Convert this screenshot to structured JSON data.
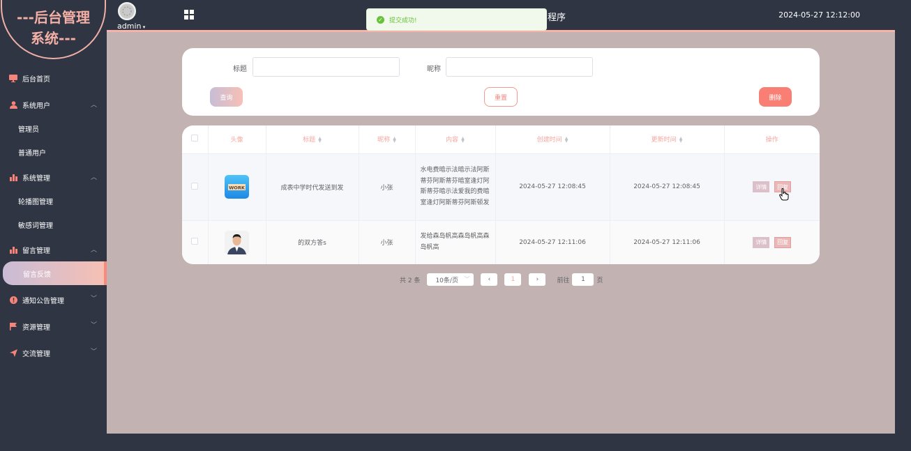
{
  "logo": {
    "line1": "---后台管理",
    "line2": "系统---"
  },
  "topbar": {
    "user": "admin",
    "title": "程序",
    "datetime": "2024-05-27 12:12:00"
  },
  "toast": {
    "message": "提交成功!"
  },
  "sidebar": {
    "items": [
      {
        "label": "后台首页",
        "icon": "monitor-icon"
      },
      {
        "label": "系统用户",
        "icon": "user-icon",
        "children": [
          "管理员",
          "普通用户"
        ]
      },
      {
        "label": "系统管理",
        "icon": "bar-chart-icon",
        "children": [
          "轮播图管理",
          "敏感词管理"
        ]
      },
      {
        "label": "留言管理",
        "icon": "bar-chart-icon",
        "children": [
          "留言反馈"
        ]
      },
      {
        "label": "通知公告管理",
        "icon": "alert-icon"
      },
      {
        "label": "资源管理",
        "icon": "flag-icon"
      },
      {
        "label": "交流管理",
        "icon": "send-icon"
      }
    ]
  },
  "search": {
    "title_label": "标题",
    "nickname_label": "昵称",
    "query_btn": "查询",
    "reset_btn": "重置",
    "delete_btn": "删除"
  },
  "table": {
    "headers": [
      "头像",
      "标题",
      "昵称",
      "内容",
      "创建时间",
      "更新时间",
      "操作"
    ],
    "rows": [
      {
        "title": "成表中学时代发送到发",
        "nickname": "小张",
        "content": "水电费暗示法暗示法阿斯蒂芬阿斯蒂芬暗室逢灯阿斯蒂芬暗示法爱我的费暗室逢灯阿斯蒂芬阿斯顿发",
        "created": "2024-05-27 12:08:45",
        "updated": "2024-05-27 12:08:45",
        "avatar_text": "WORK"
      },
      {
        "title": "的双方答s",
        "nickname": "小张",
        "content": "发给森岛帆高森岛帆高森岛帆高",
        "created": "2024-05-27 12:11:06",
        "updated": "2024-05-27 12:11:06"
      }
    ],
    "detail_btn": "详情",
    "reply_btn": "回复"
  },
  "pagination": {
    "total": "共 2 条",
    "page_size": "10条/页",
    "current": "1",
    "goto_label": "前往",
    "goto_value": "1",
    "page_suffix": "页"
  },
  "colors": {
    "accent": "#f7837a",
    "sidebar_bg": "#2f3542",
    "main_bg": "#c2b3b2"
  }
}
